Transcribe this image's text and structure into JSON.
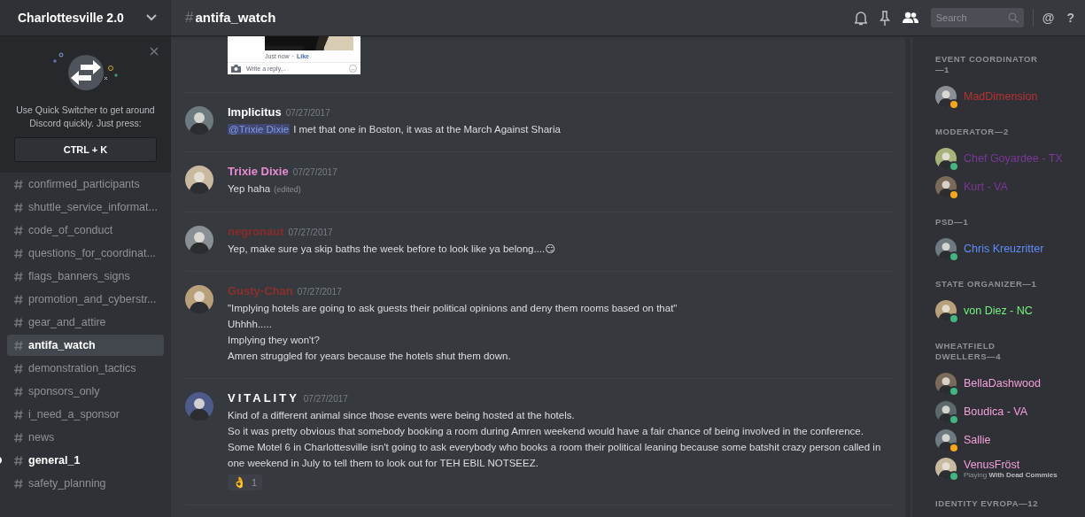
{
  "server": {
    "name": "Charlottesville 2.0"
  },
  "quick_switcher": {
    "text": "Use Quick Switcher to get around Discord quickly. Just press:",
    "shortcut": "CTRL + K"
  },
  "channels": [
    {
      "name": "confirmed_participants",
      "selected": false,
      "unread": false
    },
    {
      "name": "shuttle_service_informat...",
      "selected": false,
      "unread": false
    },
    {
      "name": "code_of_conduct",
      "selected": false,
      "unread": false
    },
    {
      "name": "questions_for_coordinat...",
      "selected": false,
      "unread": false
    },
    {
      "name": "flags_banners_signs",
      "selected": false,
      "unread": false
    },
    {
      "name": "promotion_and_cyberstr...",
      "selected": false,
      "unread": false
    },
    {
      "name": "gear_and_attire",
      "selected": false,
      "unread": false
    },
    {
      "name": "antifa_watch",
      "selected": true,
      "unread": false
    },
    {
      "name": "demonstration_tactics",
      "selected": false,
      "unread": false
    },
    {
      "name": "sponsors_only",
      "selected": false,
      "unread": false
    },
    {
      "name": "i_need_a_sponsor",
      "selected": false,
      "unread": false
    },
    {
      "name": "news",
      "selected": false,
      "unread": false
    },
    {
      "name": "general_1",
      "selected": false,
      "unread": true
    },
    {
      "name": "safety_planning",
      "selected": false,
      "unread": false
    }
  ],
  "header": {
    "hash": "#",
    "channel": "antifa_watch",
    "members_selected": true,
    "search_placeholder": "Search",
    "mention_icon": "@",
    "help_icon": "?"
  },
  "embed": {
    "timestamp": "Just now",
    "separator": "·",
    "like": "Like",
    "reply_placeholder": "Write a reply..."
  },
  "messages": [
    {
      "author": "Implicitus",
      "color": "#ffffff",
      "spaced": false,
      "time": "07/27/2017",
      "mention": "@Trixie Dixie",
      "lines": [
        "I met that one in Boston, it was at the March Against Sharia"
      ]
    },
    {
      "author": "Trixie Dixie",
      "color": "#e98ad4",
      "spaced": false,
      "time": "07/27/2017",
      "edited": "(edited)",
      "lines": [
        "Yep haha"
      ]
    },
    {
      "author": "negronaut",
      "color": "#8a2b2b",
      "spaced": false,
      "time": "07/27/2017",
      "lines": [
        "Yep, make sure ya skip baths the week before to look like ya belong....😏"
      ]
    },
    {
      "author": "Gusty-Chan",
      "color": "#8e2f2f",
      "spaced": false,
      "time": "07/27/2017",
      "lines": [
        "\"Implying hotels are going to ask guests their political opinions and deny them rooms based on that\"",
        "Uhhhh.....",
        "Implying they won't?",
        "Amren struggled for years because the hotels shut them down."
      ]
    },
    {
      "author": "VITALITY",
      "color": "#ffffff",
      "spaced": true,
      "time": "07/27/2017",
      "lines": [
        "Kind of a different animal since those events were being hosted at the hotels.",
        "So it was pretty obvious that somebody booking a room during Amren weekend would have a fair chance of being involved in the conference.",
        "Some Motel 6 in Charlottesville isn't going to ask everybody who books a room their political leaning because some batshit crazy person called in one weekend in July to tell them to look out for TEH EBIL NOTSEEZ."
      ],
      "reaction": {
        "emoji": "👌",
        "count": "1"
      }
    }
  ],
  "member_groups": [
    {
      "title": "EVENT COORDINATOR—1",
      "members": [
        {
          "name": "MadDimension",
          "color": "#b8322f",
          "idle": true
        }
      ]
    },
    {
      "title": "MODERATOR—2",
      "members": [
        {
          "name": "Chef Goyardee - TX",
          "color": "#7b3799",
          "idle": false
        },
        {
          "name": "Kurt - VA",
          "color": "#7b3799",
          "idle": true
        }
      ]
    },
    {
      "title": "PSD—1",
      "members": [
        {
          "name": "Chris Kreuzritter",
          "color": "#5e8dfb",
          "idle": false
        }
      ]
    },
    {
      "title": "STATE ORGANIZER—1",
      "members": [
        {
          "name": "von Diez - NC",
          "color": "#77f27f",
          "idle": false
        }
      ]
    },
    {
      "title": "WHEATFIELD DWELLERS—4",
      "members": [
        {
          "name": "BellaDashwood",
          "color": "#f3a0dc",
          "idle": false
        },
        {
          "name": "Boudica - VA",
          "color": "#f3a0dc",
          "idle": false
        },
        {
          "name": "Sallie",
          "color": "#f3a0dc",
          "idle": true
        },
        {
          "name": "VenusFröst",
          "color": "#f3a0dc",
          "idle": false,
          "activity": "Playing",
          "game": "With Dead Commies"
        }
      ]
    },
    {
      "title": "IDENTITY EVROPA—12"
    }
  ]
}
